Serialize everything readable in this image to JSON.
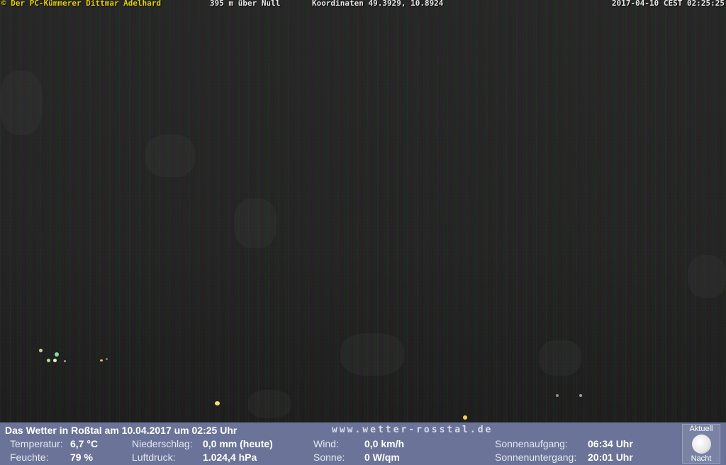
{
  "overlay": {
    "copyright": "© Der PC-Kümmerer Dittmar Adelhard",
    "altitude": "395 m über Null",
    "coordinates": "Koordinaten 49.3929, 10.8924",
    "timestamp": "2017-04-10 CEST 02:25:25"
  },
  "weather": {
    "title": "Das Wetter in Roßtal am 10.04.2017 um 02:25 Uhr",
    "website": "www.wetter-rosstal.de",
    "temperature_label": "Temperatur:",
    "temperature_value": "6,7 °C",
    "humidity_label": "Feuchte:",
    "humidity_value": "79 %",
    "precipitation_label": "Niederschlag:",
    "precipitation_value": "0,0 mm (heute)",
    "pressure_label": "Luftdruck:",
    "pressure_value": "1.024,4 hPa",
    "wind_label": "Wind:",
    "wind_value": "0,0 km/h",
    "sun_label": "Sonne:",
    "sun_value": "0 W/qm",
    "sunrise_label": "Sonnenaufgang:",
    "sunrise_value": "06:34 Uhr",
    "sunset_label": "Sonnenuntergang:",
    "sunset_value": "20:01 Uhr",
    "moon_top_label": "Aktuell",
    "moon_bottom_label": "Nacht",
    "moon_icon": "full-moon-icon"
  }
}
